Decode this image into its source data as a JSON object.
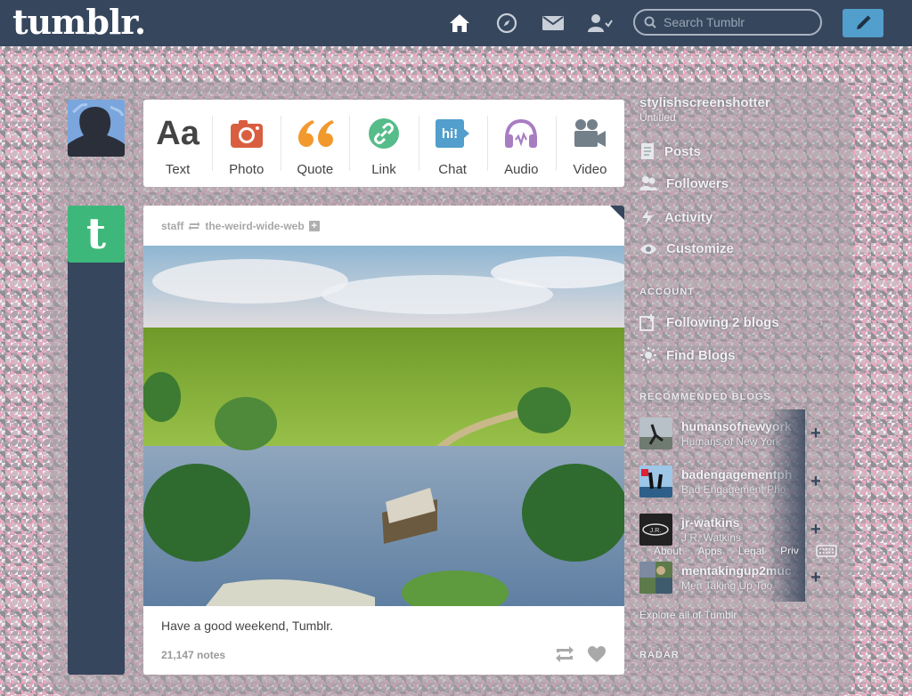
{
  "header": {
    "logo": "tumblr.",
    "search_placeholder": "Search Tumblr",
    "icons": [
      "home-icon",
      "explore-icon",
      "inbox-icon",
      "account-icon"
    ],
    "compose_icon": "pencil-icon",
    "bg_color": "#36465d",
    "compose_color": "#529ecc"
  },
  "post_types": [
    {
      "label": "Text",
      "icon": "text-icon",
      "color": "#444444"
    },
    {
      "label": "Photo",
      "icon": "camera-icon",
      "color": "#d95e40"
    },
    {
      "label": "Quote",
      "icon": "quote-icon",
      "color": "#f2992e"
    },
    {
      "label": "Link",
      "icon": "link-icon",
      "color": "#56bc8a"
    },
    {
      "label": "Chat",
      "icon": "chat-icon",
      "color": "#529ecc"
    },
    {
      "label": "Audio",
      "icon": "headphones-icon",
      "color": "#a77dc2"
    },
    {
      "label": "Video",
      "icon": "video-camera-icon",
      "color": "#748089"
    }
  ],
  "post": {
    "author": "staff",
    "reblogged_from": "the-weird-wide-web",
    "caption": "Have a good weekend, Tumblr.",
    "notes": "21,147 notes"
  },
  "right_column": {
    "blog_name": "stylishscreenshotter",
    "blog_subtitle": "Untitled",
    "blog_menu": [
      {
        "label": "Posts",
        "icon": "posts-icon"
      },
      {
        "label": "Followers",
        "icon": "followers-icon"
      },
      {
        "label": "Activity",
        "icon": "activity-icon"
      },
      {
        "label": "Customize",
        "icon": "eye-icon"
      }
    ],
    "account_label": "ACCOUNT",
    "account_menu": [
      {
        "label": "Following 2 blogs",
        "icon": "following-icon"
      },
      {
        "label": "Find Blogs",
        "icon": "find-blogs-icon"
      }
    ],
    "recommended_label": "RECOMMENDED BLOGS",
    "recommended": [
      {
        "name": "humansofnewyork",
        "sub": "Humans of New York"
      },
      {
        "name": "badengagementph",
        "sub": "Bad Engagement Pho"
      },
      {
        "name": "jr-watkins",
        "sub": "J.R. Watkins"
      },
      {
        "name": "mentakingup2muc",
        "sub": "Men Taking Up Too"
      }
    ],
    "footer_links": [
      "About",
      "Apps",
      "Legal",
      "Priv"
    ],
    "explore_label": "Explore all of Tumblr",
    "radar_label": "RADAR"
  }
}
